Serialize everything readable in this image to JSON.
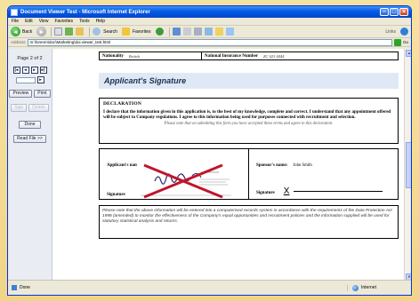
{
  "window": {
    "title": "Document Viewer Test - Microsoft Internet Explorer"
  },
  "menu": [
    "File",
    "Edit",
    "View",
    "Favorites",
    "Tools",
    "Help"
  ],
  "toolbar": {
    "back_label": "Back",
    "search_label": "Search",
    "favorites_label": "Favorites",
    "links_label": "Links"
  },
  "address": {
    "label": "Address",
    "url": "m:\\forenm\\doc\\Marketing\\doi.viewer_test.html",
    "go_label": "Go"
  },
  "sidebar": {
    "page_label": "Page 2 of 2",
    "nav_first": "|◂",
    "nav_prev": "◂",
    "nav_next": "▸",
    "nav_last": "▸|",
    "go_small": "▸",
    "preview": "Preview",
    "print": "Print",
    "sign": "Sign",
    "delete": "Delete",
    "done": "Done",
    "read_file": "Read File >>"
  },
  "zoom_level": "+0.0.0",
  "document": {
    "nationality_label": "Nationality",
    "nationality_value": "British",
    "ni_label": "National Insurance Number",
    "ni_value": "ZC 023 4444",
    "section_title": "Applicant's Signature",
    "declaration_heading": "DECLARATION",
    "declaration_text": "I declare that the information given in this application is, to the best of my knowledge, complete and correct.  I understand that any appointment offered will be subject to Company regulations.  I agree to this information being used for purposes connected with recruitment and selection.",
    "declaration_note": "Please note that on submitting this form you have accepted these terms and agree to this declaration.",
    "applicant_name_label": "Applicant's name:",
    "applicant_name_value": "William Hayes",
    "signature_label": "Signature",
    "sponsor_name_label": "Sponsor's name:",
    "sponsor_name_value": "John Smith",
    "sponsor_signature_label": "Signature",
    "sponsor_signature_mark": "X",
    "data_protection_note": "Please note that the above information will be entered into a computerised records system in accordance with the requirements of the Data Protection Act 1998 (amended) to monitor the effectiveness of the Company's equal opportunities and recruitment policies and the information supplied will be used for statutory statistical analysis and returns."
  },
  "status": {
    "text": "Done",
    "zone": "Internet"
  }
}
